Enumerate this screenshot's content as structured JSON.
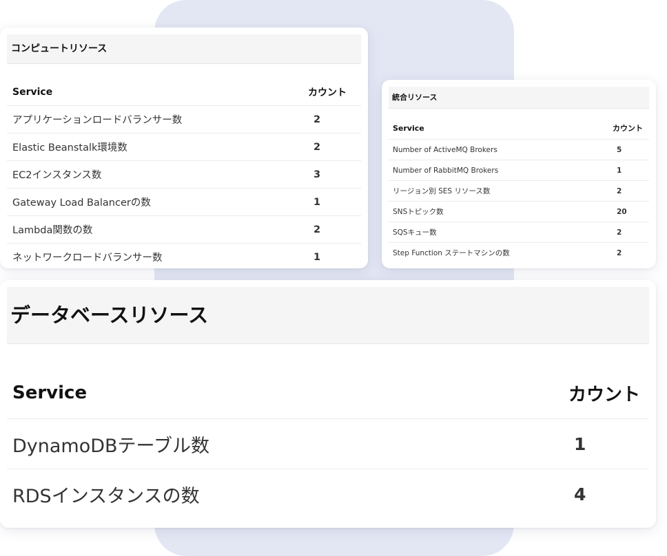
{
  "compute": {
    "title": "コンピュートリソース",
    "header_service": "Service",
    "header_count": "カウント",
    "rows": [
      {
        "service": "アプリケーションロードバランサー数",
        "count": "2"
      },
      {
        "service": "Elastic Beanstalk環境数",
        "count": "2"
      },
      {
        "service": "EC2インスタンス数",
        "count": "3"
      },
      {
        "service": "Gateway Load Balancerの数",
        "count": "1"
      },
      {
        "service": "Lambda関数の数",
        "count": "2"
      },
      {
        "service": "ネットワークロードバランサー数",
        "count": "1"
      }
    ]
  },
  "integration": {
    "title": "統合リソース",
    "header_service": "Service",
    "header_count": "カウント",
    "rows": [
      {
        "service": "Number of ActiveMQ Brokers",
        "count": "5"
      },
      {
        "service": "Number of RabbitMQ Brokers",
        "count": "1"
      },
      {
        "service": "リージョン別 SES リソース数",
        "count": "2"
      },
      {
        "service": "SNSトピック数",
        "count": "20"
      },
      {
        "service": "SQSキュー数",
        "count": "2"
      },
      {
        "service": "Step Function ステートマシンの数",
        "count": "2"
      }
    ]
  },
  "database": {
    "title": "データベースリソース",
    "header_service": "Service",
    "header_count": "カウント",
    "rows": [
      {
        "service": "DynamoDBテーブル数",
        "count": "1"
      },
      {
        "service": "RDSインスタンスの数",
        "count": "4"
      }
    ]
  }
}
